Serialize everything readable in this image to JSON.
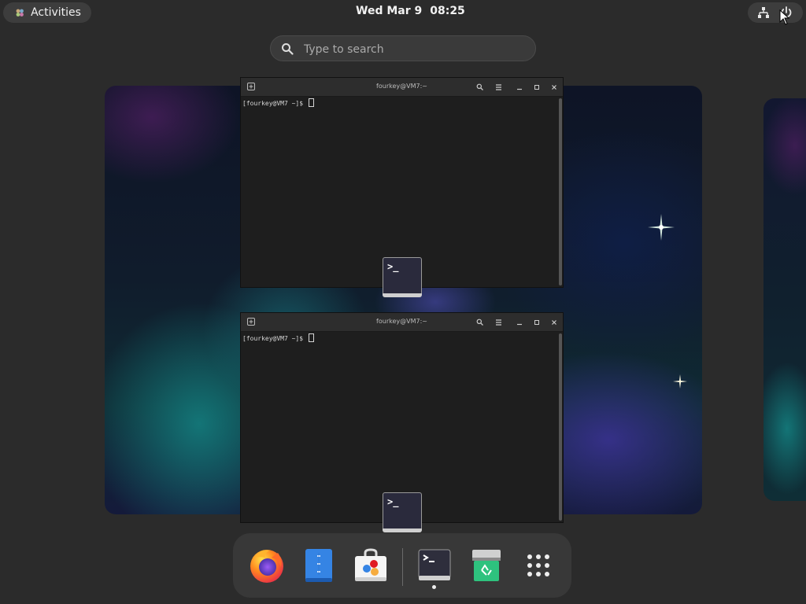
{
  "topbar": {
    "activities_label": "Activities",
    "clock_date": "Wed Mar 9",
    "clock_time": "08:25",
    "icons": [
      "network-icon",
      "power-icon"
    ]
  },
  "search": {
    "placeholder": "Type to search"
  },
  "windows": [
    {
      "title": "fourkey@VM7:~",
      "prompt": "[fourkey@VM7 ~]$ ",
      "app_icon": "terminal-icon"
    },
    {
      "title": "fourkey@VM7:~",
      "prompt": "[fourkey@VM7 ~]$ ",
      "app_icon": "terminal-icon"
    }
  ],
  "dock": {
    "items": [
      {
        "name": "firefox",
        "icon": "firefox-icon"
      },
      {
        "name": "files",
        "icon": "files-icon"
      },
      {
        "name": "software",
        "icon": "software-store-icon"
      },
      {
        "name": "terminal",
        "icon": "terminal-icon",
        "running": true
      },
      {
        "name": "trash",
        "icon": "trash-icon"
      },
      {
        "name": "show-apps",
        "icon": "app-grid-icon"
      }
    ]
  },
  "colors": {
    "panel": "#3d3d3d",
    "overview_bg": "#2b2b2b",
    "dock_bg": "#383838",
    "terminal_bg": "#1e1e1e",
    "titlebar": "#2d2d2d"
  }
}
